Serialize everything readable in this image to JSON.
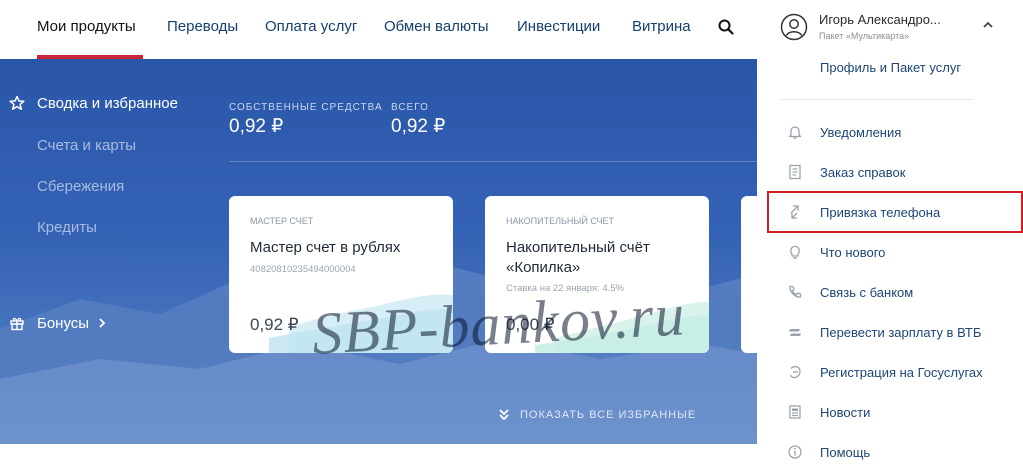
{
  "nav": {
    "items": [
      "Мои продукты",
      "Переводы",
      "Оплата услуг",
      "Обмен валюты",
      "Инвестиции",
      "Витрина"
    ],
    "search_icon": "search-icon"
  },
  "sidebar": {
    "favorites": "Сводка и избранное",
    "accounts": "Счета и карты",
    "savings": "Сбережения",
    "credits": "Кредиты",
    "bonuses": "Бонусы"
  },
  "balances": {
    "own_label": "Собственные средства",
    "own_value": "0,92 ₽",
    "total_label": "Всего",
    "total_value": "0,92 ₽"
  },
  "cards": [
    {
      "kind": "Мастер счет",
      "title": "Мастер счет в рублях",
      "sub": "40820810235494000004",
      "amount": "0,92 ₽"
    },
    {
      "kind": "Накопительный счет",
      "title": "Накопительный счёт «Копилка»",
      "sub": "Ставка на 22 января: 4.5%",
      "amount": "0,00 ₽"
    }
  ],
  "show_all": "Показать все избранные",
  "watermark": "SBP-bankov.ru",
  "profile": {
    "name": "Игорь Александро...",
    "package": "Пакет «Мультикарта»",
    "profile_link": "Профиль и Пакет услуг"
  },
  "menu": [
    {
      "label": "Уведомления",
      "icon": "bell-icon"
    },
    {
      "label": "Заказ справок",
      "icon": "document-icon"
    },
    {
      "label": "Привязка телефона",
      "icon": "phone-link-icon"
    },
    {
      "label": "Что нового",
      "icon": "lightbulb-icon"
    },
    {
      "label": "Связь с банком",
      "icon": "phone-icon"
    },
    {
      "label": "Перевести зарплату в ВТБ",
      "icon": "transfer-icon"
    },
    {
      "label": "Регистрация на Госуслугах",
      "icon": "gosuslugi-icon"
    },
    {
      "label": "Новости",
      "icon": "news-icon"
    },
    {
      "label": "Помощь",
      "icon": "help-icon"
    }
  ],
  "colors": {
    "accent": "#c8263b",
    "link": "#1d4677",
    "highlight": "#d21f26"
  }
}
